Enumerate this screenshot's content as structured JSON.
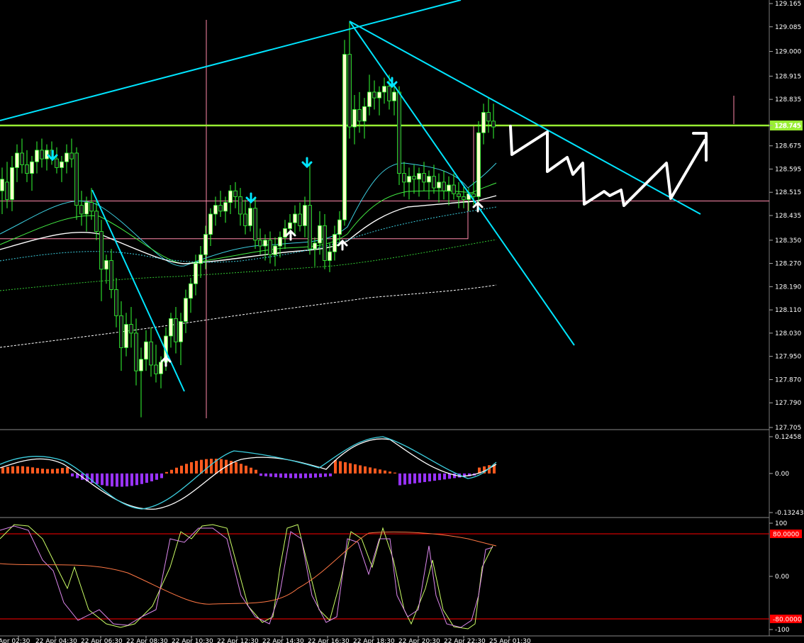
{
  "chart_data": [
    {
      "type": "candlestick",
      "panel": "price",
      "y_ticks": [
        "129.165",
        "129.085",
        "129.000",
        "128.915",
        "128.835",
        "128.745",
        "128.675",
        "128.595",
        "128.515",
        "128.435",
        "128.350",
        "128.270",
        "128.190",
        "128.110",
        "128.030",
        "127.950",
        "127.870",
        "127.790",
        "127.705"
      ],
      "ylim": [
        127.705,
        129.165
      ],
      "current_price_label": "128.745",
      "levels": {
        "green_line": 128.745,
        "pink_line": 128.485,
        "box_bottom": 128.355
      },
      "colors": {
        "up_body": "#ffffcc",
        "down_body": "#1a1a1a",
        "wick": "#33ff33",
        "trend": "#00e5ff",
        "level": "#99ee33",
        "pink": "#ff88aa",
        "arrow_down": "#00e5ff",
        "arrow_up": "#ffffff",
        "projection": "#ffffff",
        "background": "#000000"
      }
    },
    {
      "type": "bar",
      "panel": "macd",
      "y_ticks": [
        "0.12458",
        "0.00",
        "-0.13243"
      ],
      "ylim": [
        -0.13243,
        0.12458
      ],
      "colors": {
        "positive": "#ff5a1f",
        "negative": "#9933ff",
        "fast_line": "#ffffff",
        "signal_line": "#3ccfe0"
      }
    },
    {
      "type": "line",
      "panel": "stochastic",
      "y_ticks": [
        "100",
        "0.00",
        "-100"
      ],
      "ylim": [
        -100,
        100
      ],
      "levels": [
        "80.0000",
        "-80.0000"
      ],
      "colors": {
        "level": "#ff0000",
        "k_line": "#ccff66",
        "d_line": "#dd88ee",
        "slow_line": "#ff7744"
      }
    }
  ],
  "time_labels": [
    "Apr 02:30",
    "22 Apr 04:30",
    "22 Apr 06:30",
    "22 Apr 08:30",
    "22 Apr 10:30",
    "22 Apr 12:30",
    "22 Apr 14:30",
    "22 Apr 16:30",
    "22 Apr 18:30",
    "22 Apr 20:30",
    "22 Apr 22:30",
    "25 Apr 01:30"
  ]
}
